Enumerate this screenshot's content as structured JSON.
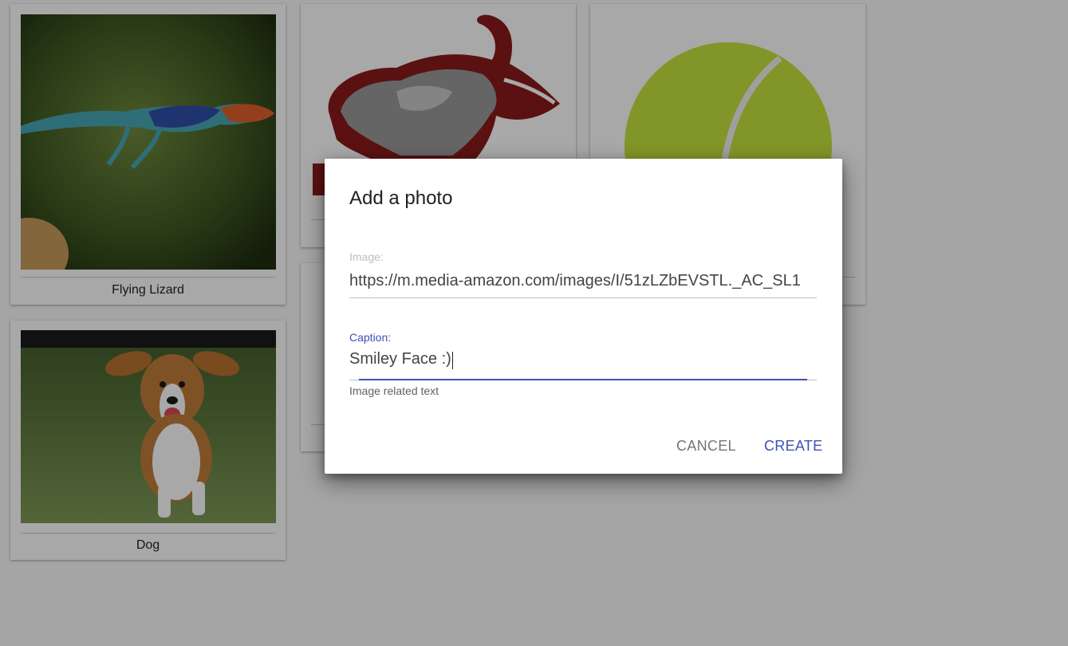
{
  "gallery": {
    "cards": [
      {
        "caption": "Flying Lizard"
      },
      {
        "caption": ""
      },
      {
        "caption": ""
      },
      {
        "caption": ""
      },
      {
        "caption": "Dog"
      }
    ]
  },
  "dialog": {
    "title": "Add a photo",
    "image_field": {
      "label": "Image:",
      "value": "https://m.media-amazon.com/images/I/51zLZbEVSTL._AC_SL1"
    },
    "caption_field": {
      "label": "Caption:",
      "value": "Smiley Face :)",
      "helper": "Image related text"
    },
    "buttons": {
      "cancel": "CANCEL",
      "create": "CREATE"
    }
  },
  "colors": {
    "accent": "#3f51b5",
    "logo_red": "#8b1a1a",
    "tennis_ball": "#c6e33d"
  }
}
